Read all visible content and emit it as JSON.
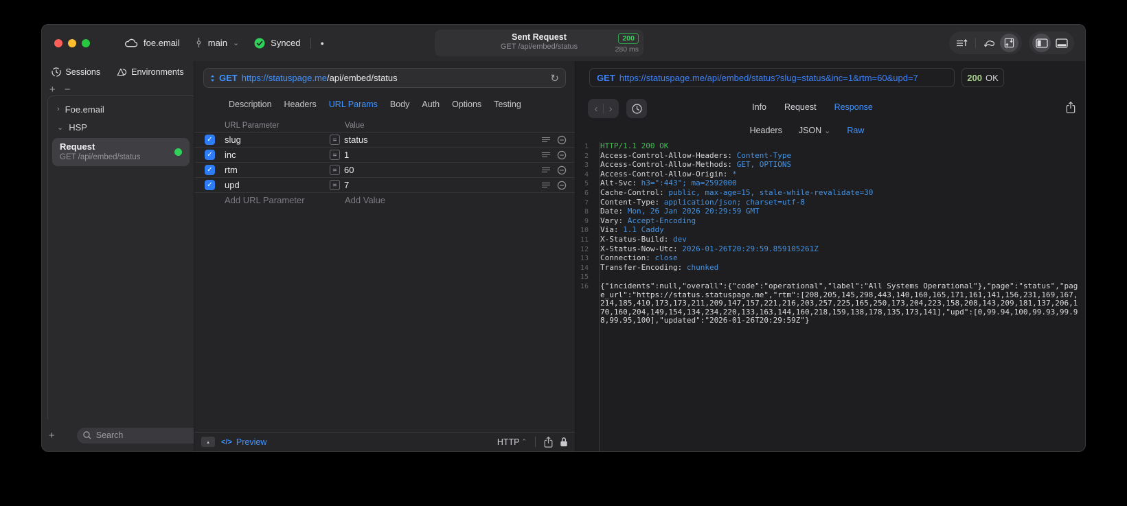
{
  "colors": {
    "accent_blue": "#4094ff",
    "checkbox_blue": "#2f7cf7",
    "green": "#30d158",
    "response_code_green": "#a8cf8c",
    "mono_value_blue": "#4693e2",
    "mono_status_green": "#3fbf52",
    "window_bg": "#2a2a2c",
    "middle_pane_bg": "#252528",
    "right_pane_bg": "#1e1e20"
  },
  "icons": {
    "plus": "+",
    "minus": "−",
    "chevron_right": "›",
    "chevron_down": "⌄",
    "caret_up": "⌃",
    "back": "‹",
    "forward": "›",
    "refresh": "↻",
    "check": "✓",
    "code": "</>",
    "collapse": "▴",
    "dot": "●",
    "equals": "="
  },
  "titlebar": {
    "project": "foe.email",
    "branch": "main",
    "sync_label": "Synced",
    "request_summary": {
      "title": "Sent Request",
      "subtitle": "GET /api/embed/status",
      "status_code": "200",
      "duration": "280 ms"
    }
  },
  "sidebar": {
    "tabs": [
      {
        "label": "Sessions"
      },
      {
        "label": "Environments"
      }
    ],
    "tree": [
      {
        "label": "Foe.email",
        "expanded": false
      },
      {
        "label": "HSP",
        "expanded": true
      }
    ],
    "request_item": {
      "title": "Request",
      "subtitle": "GET /api/embed/status"
    },
    "search": {
      "placeholder": "Search"
    }
  },
  "request_pane": {
    "method": "GET",
    "url_host": "https://statuspage.me",
    "url_path": "/api/embed/status",
    "tabs": [
      "Description",
      "Headers",
      "URL Params",
      "Body",
      "Auth",
      "Options",
      "Testing"
    ],
    "active_tab": "URL Params",
    "params": {
      "columns": [
        "URL Parameter",
        "Value"
      ],
      "rows": [
        {
          "name": "slug",
          "value": "status",
          "enabled": true
        },
        {
          "name": "inc",
          "value": "1",
          "enabled": true
        },
        {
          "name": "rtm",
          "value": "60",
          "enabled": true
        },
        {
          "name": "upd",
          "value": "7",
          "enabled": true
        }
      ],
      "add_parameter_placeholder": "Add URL Parameter",
      "add_value_placeholder": "Add Value"
    },
    "footer": {
      "preview_label": "Preview",
      "protocol": "HTTP"
    }
  },
  "response_pane": {
    "request_method": "GET",
    "request_url": "https://statuspage.me/api/embed/status?slug=status&inc=1&rtm=60&upd=7",
    "status_code": "200",
    "status_text": "OK",
    "tabs": [
      "Info",
      "Request",
      "Response"
    ],
    "active_tab": "Response",
    "subtabs": [
      "Headers",
      "JSON",
      "Raw"
    ],
    "active_subtab": "Raw",
    "lines": [
      {
        "num": "1",
        "segments": [
          {
            "text": "HTTP/1.1 200 OK",
            "style": "status"
          }
        ]
      },
      {
        "num": "2",
        "segments": [
          {
            "text": "Access-Control-Allow-Headers: ",
            "style": "name"
          },
          {
            "text": "Content-Type",
            "style": "value"
          }
        ]
      },
      {
        "num": "3",
        "segments": [
          {
            "text": "Access-Control-Allow-Methods: ",
            "style": "name"
          },
          {
            "text": "GET, OPTIONS",
            "style": "value"
          }
        ]
      },
      {
        "num": "4",
        "segments": [
          {
            "text": "Access-Control-Allow-Origin: ",
            "style": "name"
          },
          {
            "text": "*",
            "style": "value"
          }
        ]
      },
      {
        "num": "5",
        "segments": [
          {
            "text": "Alt-Svc: ",
            "style": "name"
          },
          {
            "text": "h3=\":443\"; ma=2592000",
            "style": "value"
          }
        ]
      },
      {
        "num": "6",
        "segments": [
          {
            "text": "Cache-Control: ",
            "style": "name"
          },
          {
            "text": "public, max-age=15, stale-while-revalidate=30",
            "style": "value"
          }
        ]
      },
      {
        "num": "7",
        "segments": [
          {
            "text": "Content-Type: ",
            "style": "name"
          },
          {
            "text": "application/json; charset=utf-8",
            "style": "value"
          }
        ]
      },
      {
        "num": "8",
        "segments": [
          {
            "text": "Date: ",
            "style": "name"
          },
          {
            "text": "Mon, 26 Jan 2026 20:29:59 GMT",
            "style": "value"
          }
        ]
      },
      {
        "num": "9",
        "segments": [
          {
            "text": "Vary: ",
            "style": "name"
          },
          {
            "text": "Accept-Encoding",
            "style": "value"
          }
        ]
      },
      {
        "num": "10",
        "segments": [
          {
            "text": "Via: ",
            "style": "name"
          },
          {
            "text": "1.1 Caddy",
            "style": "value"
          }
        ]
      },
      {
        "num": "11",
        "segments": [
          {
            "text": "X-Status-Build: ",
            "style": "name"
          },
          {
            "text": "dev",
            "style": "value"
          }
        ]
      },
      {
        "num": "12",
        "segments": [
          {
            "text": "X-Status-Now-Utc: ",
            "style": "name"
          },
          {
            "text": "2026-01-26T20:29:59.859105261Z",
            "style": "value"
          }
        ]
      },
      {
        "num": "13",
        "segments": [
          {
            "text": "Connection: ",
            "style": "name"
          },
          {
            "text": "close",
            "style": "value"
          }
        ]
      },
      {
        "num": "14",
        "segments": [
          {
            "text": "Transfer-Encoding: ",
            "style": "name"
          },
          {
            "text": "chunked",
            "style": "value"
          }
        ]
      },
      {
        "num": "15",
        "segments": []
      },
      {
        "num": "16",
        "segments": [
          {
            "text": "{\"incidents\":null,\"overall\":{\"code\":\"operational\",\"label\":\"All Systems Operational\"},\"page\":\"status\",\"page_url\":\"https://status.statuspage.me\",\"rtm\":[208,205,145,298,443,140,160,165,171,161,141,156,231,169,167,214,185,410,173,173,211,209,147,157,221,216,203,257,225,165,250,173,204,223,158,208,143,209,181,137,206,170,160,204,149,154,134,234,220,133,163,144,160,218,159,138,178,135,173,141],\"upd\":[0,99.94,100,99.93,99.98,99.95,100],\"updated\":\"2026-01-26T20:29:59Z\"}",
            "style": "body"
          }
        ]
      }
    ]
  }
}
